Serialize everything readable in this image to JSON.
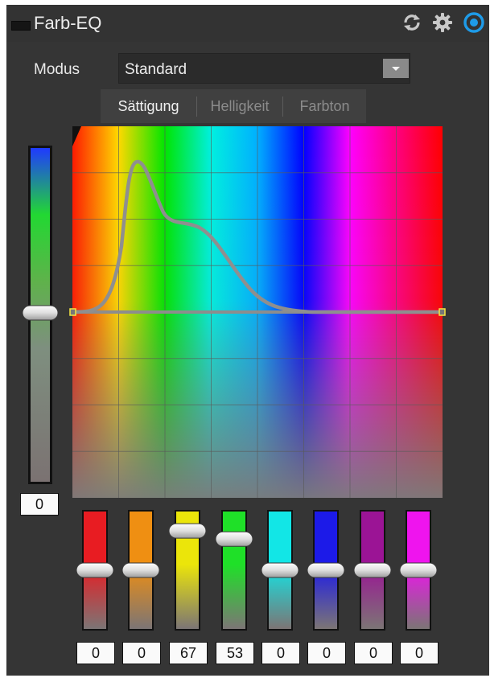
{
  "header": {
    "title": "Farb-EQ",
    "icons": [
      "collapse-icon",
      "reset-icon",
      "settings-icon",
      "enable-icon"
    ],
    "accent": "#1e9be8"
  },
  "mode": {
    "label": "Modus",
    "value": "Standard"
  },
  "tabs": [
    {
      "label": "Sättigung",
      "active": true
    },
    {
      "label": "Helligkeit",
      "active": false
    },
    {
      "label": "Farbton",
      "active": false
    }
  ],
  "master": {
    "value": "0",
    "level": 0.5
  },
  "bands": [
    {
      "value": "0",
      "color": "#e81c22",
      "level": 0.5
    },
    {
      "value": "0",
      "color": "#ef8f12",
      "level": 0.5
    },
    {
      "value": "67",
      "color": "#ebe50a",
      "level": 0.835
    },
    {
      "value": "53",
      "color": "#1fe028",
      "level": 0.765
    },
    {
      "value": "0",
      "color": "#12e6e6",
      "level": 0.5
    },
    {
      "value": "0",
      "color": "#1c1ae8",
      "level": 0.5
    },
    {
      "value": "0",
      "color": "#9b1495",
      "level": 0.5
    },
    {
      "value": "0",
      "color": "#ef14ee",
      "level": 0.5
    }
  ]
}
